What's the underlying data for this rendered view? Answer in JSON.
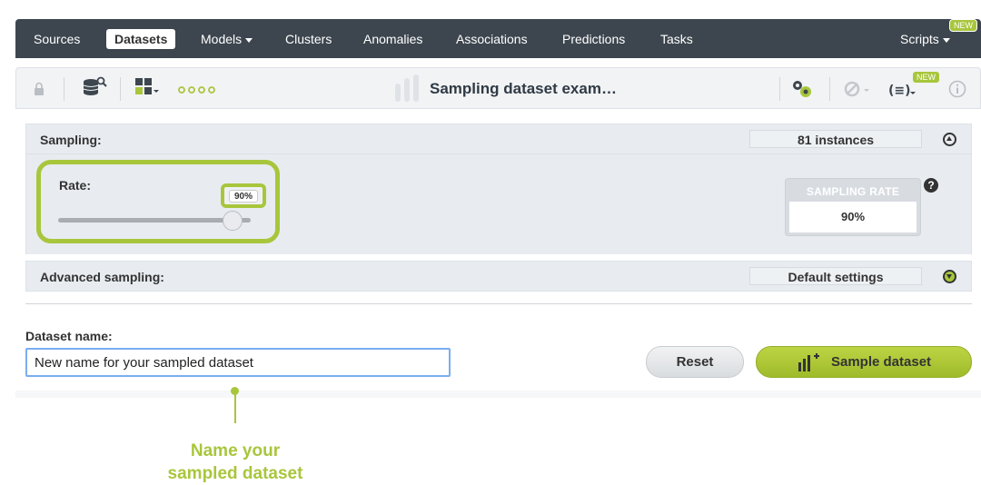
{
  "nav": {
    "items": [
      {
        "label": "Sources"
      },
      {
        "label": "Datasets"
      },
      {
        "label": "Models"
      },
      {
        "label": "Clusters"
      },
      {
        "label": "Anomalies"
      },
      {
        "label": "Associations"
      },
      {
        "label": "Predictions"
      },
      {
        "label": "Tasks"
      }
    ],
    "active": "Datasets",
    "scripts_label": "Scripts",
    "scripts_badge": "NEW"
  },
  "toolbar": {
    "title": "Sampling dataset exam…",
    "icons": [
      "lock-icon",
      "dataset-search-icon",
      "fields-icon",
      "progress-dots-icon",
      "config-gears-icon",
      "cluster-icon",
      "filter-menu-icon",
      "info-icon"
    ],
    "filter_badge": "NEW"
  },
  "sampling": {
    "title": "Sampling:",
    "instances": "81 instances",
    "rate_label": "Rate:",
    "rate_value": "90%",
    "rate_fraction": 0.9,
    "sampling_rate_title": "SAMPLING RATE",
    "sampling_rate_value": "90%"
  },
  "advanced": {
    "title": "Advanced sampling:",
    "value": "Default settings"
  },
  "dataset_name": {
    "label": "Dataset name:",
    "value": "New name for your sampled dataset"
  },
  "buttons": {
    "reset": "Reset",
    "sample": "Sample dataset"
  },
  "callout": {
    "line1": "Name your",
    "line2": "sampled dataset"
  },
  "colors": {
    "accent": "#a8c63c",
    "nav_bg": "#3d464f"
  }
}
